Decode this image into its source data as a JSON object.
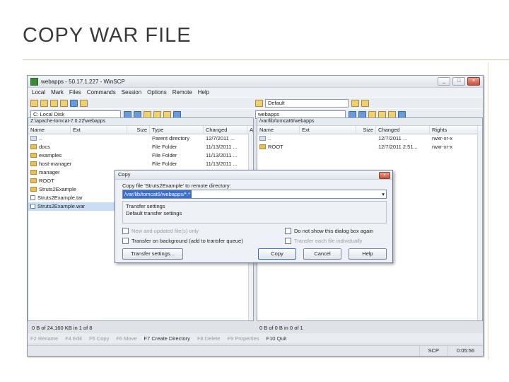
{
  "slide": {
    "title": "COPY WAR FILE"
  },
  "window": {
    "title": "webapps - 50.17.1.227 - WinSCP",
    "controls": [
      "_",
      "□",
      "×"
    ]
  },
  "menu": [
    "Local",
    "Mark",
    "Files",
    "Commands",
    "Session",
    "Options",
    "Remote",
    "Help"
  ],
  "left": {
    "drive": "C: Local Disk",
    "path": "Z:\\apache-tomcat-7.0.22\\webapps",
    "columns": [
      "Name",
      "Ext",
      "Size",
      "Type",
      "Changed",
      "A"
    ],
    "rows": [
      {
        "name": "..",
        "type": "Parent directory",
        "changed": "12/7/2011 ..."
      },
      {
        "name": "docs",
        "type": "File Folder",
        "changed": "11/13/2011 ..."
      },
      {
        "name": "examples",
        "type": "File Folder",
        "changed": "11/13/2011 ..."
      },
      {
        "name": "host-manager",
        "type": "File Folder",
        "changed": "11/13/2011 ..."
      },
      {
        "name": "manager",
        "type": "",
        "changed": ""
      },
      {
        "name": "ROOT",
        "type": "",
        "changed": ""
      },
      {
        "name": "Struts2Example",
        "type": "",
        "changed": ""
      },
      {
        "name": "Struts2Example.tar",
        "type": "",
        "changed": ""
      },
      {
        "name": "Struts2Example.war",
        "type": "",
        "changed": ""
      }
    ],
    "status": "0 B of 24,160 KB in 1 of 8"
  },
  "right": {
    "drive": "webapps",
    "session": "Default",
    "path": "/var/lib/tomcat6/webapps",
    "columns": [
      "Name",
      "Ext",
      "Size",
      "Changed",
      "Rights"
    ],
    "rows": [
      {
        "name": "..",
        "changed": "12/7/2011 ...",
        "rights": "rwxr-xr-x"
      },
      {
        "name": "ROOT",
        "changed": "12/7/2011 2:51...",
        "rights": "rwxr-xr-x"
      }
    ],
    "status": "0 B of 0 B in 0 of 1"
  },
  "dialog": {
    "title": "Copy",
    "prompt": "Copy file 'Struts2Example' to remote directory:",
    "target": "/var/lib/tomcat6/webapps/*.*",
    "group_label": "Transfer settings",
    "group_value": "Default transfer settings",
    "options": {
      "new_default": "New and updated file(s) only",
      "background": "Transfer on background (add to transfer queue)",
      "dont_show": "Do not show this dialog box again",
      "transfer_directly": "Transfer each file individually"
    },
    "buttons": {
      "transfer_settings": "Transfer settings...",
      "copy": "Copy",
      "cancel": "Cancel",
      "help": "Help"
    }
  },
  "fnkeys": [
    "F2 Rename",
    "F4 Edit",
    "F5 Copy",
    "F6 Move",
    "F7 Create Directory",
    "F8 Delete",
    "F9 Properties",
    "F10 Quit"
  ],
  "statusbar": {
    "protocol": "SCP",
    "time": "0:05:56"
  }
}
